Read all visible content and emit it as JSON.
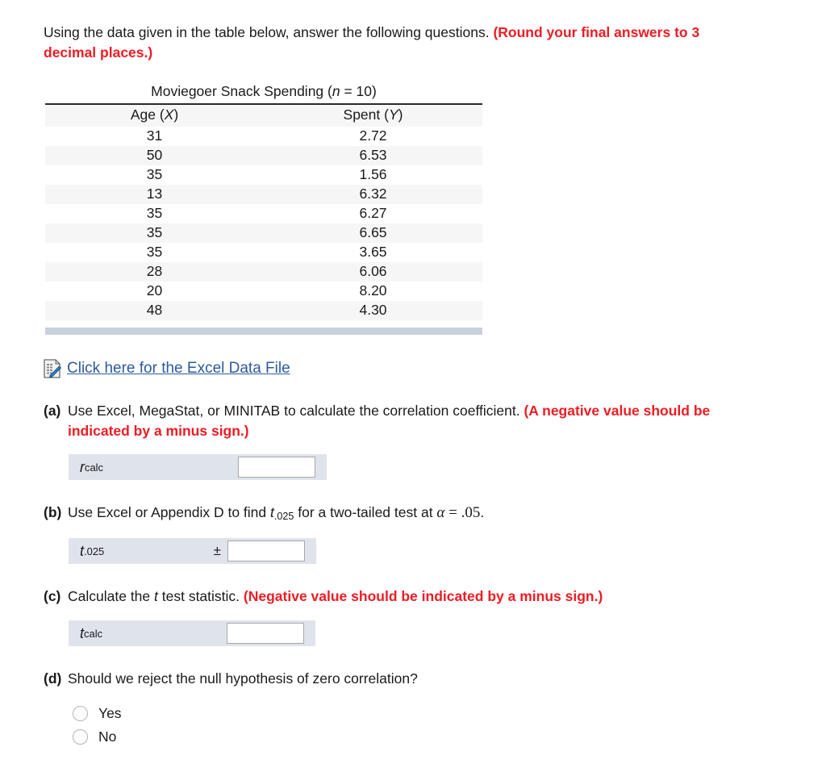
{
  "intro": {
    "text": "Using the data given in the table below, answer the following questions.",
    "note_line1": "(Round your final answers to 3",
    "note_line2": "decimal places.)"
  },
  "table": {
    "title_prefix": "Moviegoer Snack Spending (",
    "title_italic": "n",
    "title_suffix": " = 10)",
    "col_x_prefix": "Age (",
    "col_x_italic": "X",
    "col_x_suffix": ")",
    "col_y_prefix": "Spent (",
    "col_y_italic": "Y",
    "col_y_suffix": ")",
    "rows": [
      {
        "x": "31",
        "y": "2.72"
      },
      {
        "x": "50",
        "y": "6.53"
      },
      {
        "x": "35",
        "y": "1.56"
      },
      {
        "x": "13",
        "y": "6.32"
      },
      {
        "x": "35",
        "y": "6.27"
      },
      {
        "x": "35",
        "y": "6.65"
      },
      {
        "x": "35",
        "y": "3.65"
      },
      {
        "x": "28",
        "y": "6.06"
      },
      {
        "x": "20",
        "y": "8.20"
      },
      {
        "x": "48",
        "y": "4.30"
      }
    ]
  },
  "excel": {
    "icon": "spreadsheet-document-icon",
    "link_text": "Click here for the Excel Data File"
  },
  "questions": {
    "a": {
      "marker": "(a)",
      "text": "Use Excel, MegaStat, or MINITAB to calculate the correlation coefficient.",
      "note_line1": "(A negative value should be",
      "note_line2": "indicated by a minus sign.)",
      "field": {
        "label_italic": "r",
        "label_sub": "calc",
        "value": "",
        "placeholder": ""
      }
    },
    "b": {
      "marker": "(b)",
      "text_before_link": "Use Excel or ",
      "link_text": "Appendix D",
      "text_after_link": " to find ",
      "t_italic": "t",
      "t_sub": ".025",
      "text_mid": " for a two-tailed test at ",
      "alpha": "α",
      "equals": " = ",
      "alpha_value": ".05",
      "period": ".",
      "field": {
        "label_italic": "t",
        "label_sub": ".025",
        "plusminus": "±",
        "value": "",
        "placeholder": ""
      }
    },
    "c": {
      "marker": "(c)",
      "text_before": "Calculate the ",
      "t_italic": "t",
      "text_after": " test statistic.",
      "note": "(Negative value should be indicated by a minus sign.)",
      "field": {
        "label_italic": "t",
        "label_sub": "calc",
        "value": "",
        "placeholder": ""
      }
    },
    "d": {
      "marker": "(d)",
      "text": "Should we reject the null hypothesis of zero correlation?",
      "options": [
        {
          "label": "Yes",
          "selected": false
        },
        {
          "label": "No",
          "selected": false
        }
      ]
    }
  },
  "colors": {
    "red_note": "#ed1c24",
    "link_blue": "#2c5aa0",
    "table_header_bg": "#d2d8e4",
    "field_bg": "#dfe3ec",
    "row_stripe": "#f6f6f6"
  }
}
